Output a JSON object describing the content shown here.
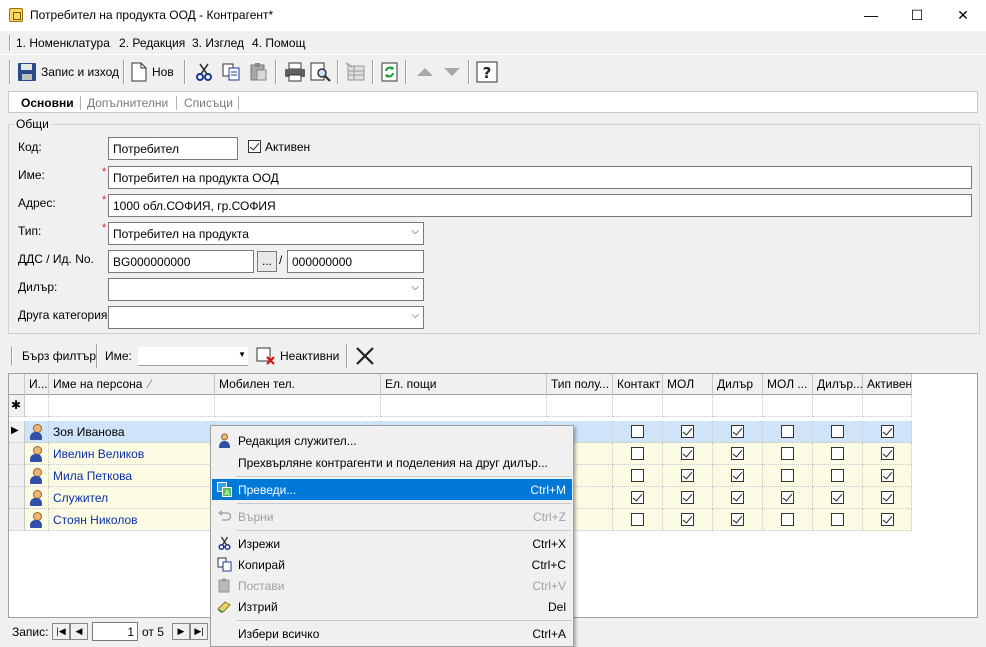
{
  "window": {
    "title": "Потребител на продукта ООД - Контрагент*",
    "minimize": "—",
    "maximize": "☐",
    "close": "✕"
  },
  "menubar": {
    "items": [
      {
        "label": "1. Номенклатура"
      },
      {
        "label": "2. Редакция"
      },
      {
        "label": "3. Изглед"
      },
      {
        "label": "4. Помощ"
      }
    ]
  },
  "toolbar": {
    "save_exit_label": "Запис и изход",
    "new_label": "Нов"
  },
  "tabs": [
    {
      "label": "Основни",
      "active": true
    },
    {
      "label": "Допълнителни",
      "active": false
    },
    {
      "label": "Списъци",
      "active": false
    }
  ],
  "general": {
    "legend": "Общи",
    "code_label": "Код:",
    "code_value": "Потребител",
    "active_label": "Активен",
    "active_checked": true,
    "name_label": "Име:",
    "name_value": "Потребител на продукта ООД",
    "address_label": "Адрес:",
    "address_value": "1000 обл.СОФИЯ, гр.СОФИЯ",
    "type_label": "Тип:",
    "type_value": "Потребител на продукта",
    "vat_label": "ДДС / Ид. No.",
    "vat_value": "BG000000000",
    "vat_button": "...",
    "vat_sep": "/",
    "id_value": "000000000",
    "dealer_label": "Дилър:",
    "dealer_value": "",
    "category_label": "Друга категория",
    "category_value": "",
    "required_mark": "*"
  },
  "quick_filter": {
    "label": "Бърз филтър",
    "name_label": "Име:",
    "name_value": "",
    "inactive_label": "Неактивни"
  },
  "grid": {
    "columns": [
      {
        "label": "И..."
      },
      {
        "label": "Име на персона"
      },
      {
        "label": "Мобилен тел."
      },
      {
        "label": "Ел. пощи"
      },
      {
        "label": "Тип полу..."
      },
      {
        "label": "Контакт"
      },
      {
        "label": "МОЛ"
      },
      {
        "label": "Дилър"
      },
      {
        "label": "МОЛ ..."
      },
      {
        "label": "Дилър..."
      },
      {
        "label": "Активен"
      }
    ],
    "sort_indicator": "⁄",
    "new_row_marker": "✱",
    "current_row_marker": "▶",
    "rows": [
      {
        "name": "Зоя Иванова",
        "contact": false,
        "mol": true,
        "dealer": true,
        "mol2": false,
        "dealer2": false,
        "active": true
      },
      {
        "name": "Ивелин Великов",
        "contact": false,
        "mol": true,
        "dealer": true,
        "mol2": false,
        "dealer2": false,
        "active": true
      },
      {
        "name": "Мила Петкова",
        "contact": false,
        "mol": true,
        "dealer": true,
        "mol2": false,
        "dealer2": false,
        "active": true
      },
      {
        "name": "Служител",
        "contact": true,
        "mol": true,
        "dealer": true,
        "mol2": true,
        "dealer2": true,
        "active": true
      },
      {
        "name": "Стоян Николов",
        "contact": false,
        "mol": true,
        "dealer": true,
        "mol2": false,
        "dealer2": false,
        "active": true
      }
    ]
  },
  "navigator": {
    "label": "Запис:",
    "current": "1",
    "of_label": "от 5"
  },
  "context_menu": {
    "items": [
      {
        "label": "Редакция служител...",
        "shortcut": "",
        "disabled": false,
        "selected": false
      },
      {
        "label": "Прехвърляне контрагенти и поделения на друг дилър...",
        "shortcut": "",
        "disabled": false,
        "selected": false
      },
      {
        "label": "Преведи...",
        "shortcut": "Ctrl+M",
        "disabled": false,
        "selected": true
      },
      {
        "label": "Върни",
        "shortcut": "Ctrl+Z",
        "disabled": true,
        "selected": false
      },
      {
        "label": "Изрежи",
        "shortcut": "Ctrl+X",
        "disabled": false,
        "selected": false
      },
      {
        "label": "Копирай",
        "shortcut": "Ctrl+C",
        "disabled": false,
        "selected": false
      },
      {
        "label": "Постави",
        "shortcut": "Ctrl+V",
        "disabled": true,
        "selected": false
      },
      {
        "label": "Изтрий",
        "shortcut": "Del",
        "disabled": false,
        "selected": false
      },
      {
        "label": "Избери всичко",
        "shortcut": "Ctrl+A",
        "disabled": false,
        "selected": false
      }
    ]
  }
}
